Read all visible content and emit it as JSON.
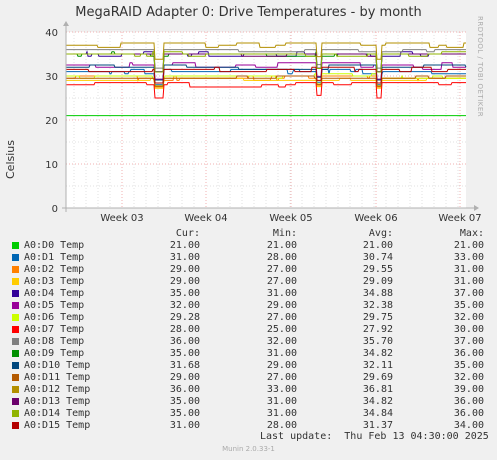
{
  "chart_data": {
    "type": "line",
    "title": "MegaRAID Adapter 0: Drive Temperatures - by month",
    "ylabel": "Celsius",
    "xlabel": "",
    "ylim": [
      0,
      40
    ],
    "yticks": [
      0,
      10,
      20,
      30,
      40
    ],
    "x_ticks": [
      "Week 03",
      "Week 04",
      "Week 05",
      "Week 06",
      "Week 07"
    ],
    "grid": true,
    "columns": [
      "Cur:",
      "Min:",
      "Avg:",
      "Max:"
    ],
    "series": [
      {
        "name": "A0:D0 Temp",
        "color": "#00cc00",
        "cur": "21.00",
        "min": "21.00",
        "avg": "21.00",
        "max": "21.00",
        "base": 21.0,
        "dip": 0,
        "noise": 0
      },
      {
        "name": "A0:D1 Temp",
        "color": "#0066b3",
        "cur": "31.00",
        "min": "28.00",
        "avg": "30.74",
        "max": "33.00",
        "base": 31.0,
        "dip": 3,
        "noise": 0.6
      },
      {
        "name": "A0:D2 Temp",
        "color": "#ff8000",
        "cur": "29.00",
        "min": "27.00",
        "avg": "29.55",
        "max": "31.00",
        "base": 29.5,
        "dip": 2,
        "noise": 0.5
      },
      {
        "name": "A0:D3 Temp",
        "color": "#ffcc00",
        "cur": "29.00",
        "min": "27.00",
        "avg": "29.09",
        "max": "31.00",
        "base": 29.2,
        "dip": 2,
        "noise": 0.5
      },
      {
        "name": "A0:D4 Temp",
        "color": "#330099",
        "cur": "35.00",
        "min": "31.00",
        "avg": "34.88",
        "max": "37.00",
        "base": 35.0,
        "dip": 4,
        "noise": 0.5
      },
      {
        "name": "A0:D5 Temp",
        "color": "#990099",
        "cur": "32.00",
        "min": "29.00",
        "avg": "32.38",
        "max": "35.00",
        "base": 32.3,
        "dip": 3,
        "noise": 0.6
      },
      {
        "name": "A0:D6 Temp",
        "color": "#ccff00",
        "cur": "29.28",
        "min": "27.00",
        "avg": "29.75",
        "max": "32.00",
        "base": 29.8,
        "dip": 2,
        "noise": 0.5
      },
      {
        "name": "A0:D7 Temp",
        "color": "#ff0000",
        "cur": "28.00",
        "min": "25.00",
        "avg": "27.92",
        "max": "30.00",
        "base": 28.0,
        "dip": 3,
        "noise": 0.5
      },
      {
        "name": "A0:D8 Temp",
        "color": "#808080",
        "cur": "36.00",
        "min": "32.00",
        "avg": "35.70",
        "max": "37.00",
        "base": 35.8,
        "dip": 4,
        "noise": 0.4
      },
      {
        "name": "A0:D9 Temp",
        "color": "#008f00",
        "cur": "35.00",
        "min": "31.00",
        "avg": "34.82",
        "max": "36.00",
        "base": 34.9,
        "dip": 4,
        "noise": 0.4
      },
      {
        "name": "A0:D10 Temp",
        "color": "#00487d",
        "cur": "31.68",
        "min": "29.00",
        "avg": "32.11",
        "max": "35.00",
        "base": 32.1,
        "dip": 3,
        "noise": 0.6
      },
      {
        "name": "A0:D11 Temp",
        "color": "#b35a00",
        "cur": "29.00",
        "min": "27.00",
        "avg": "29.69",
        "max": "32.00",
        "base": 29.7,
        "dip": 2,
        "noise": 0.5
      },
      {
        "name": "A0:D12 Temp",
        "color": "#b38f00",
        "cur": "36.00",
        "min": "33.00",
        "avg": "36.81",
        "max": "39.00",
        "base": 36.8,
        "dip": 3,
        "noise": 0.6
      },
      {
        "name": "A0:D13 Temp",
        "color": "#6b006b",
        "cur": "35.00",
        "min": "31.00",
        "avg": "34.82",
        "max": "36.00",
        "base": 34.9,
        "dip": 4,
        "noise": 0.4
      },
      {
        "name": "A0:D14 Temp",
        "color": "#8fb300",
        "cur": "35.00",
        "min": "31.00",
        "avg": "34.84",
        "max": "36.00",
        "base": 34.9,
        "dip": 4,
        "noise": 0.4
      },
      {
        "name": "A0:D15 Temp",
        "color": "#b30000",
        "cur": "31.00",
        "min": "28.00",
        "avg": "31.37",
        "max": "34.00",
        "base": 31.4,
        "dip": 3,
        "noise": 0.5
      }
    ]
  },
  "footer": {
    "last_update": "Last update:  Thu Feb 13 04:30:00 2025",
    "munin_version": "Munin 2.0.33-1",
    "side_credit": "RRDTOOL / TOBI OETIKER"
  }
}
